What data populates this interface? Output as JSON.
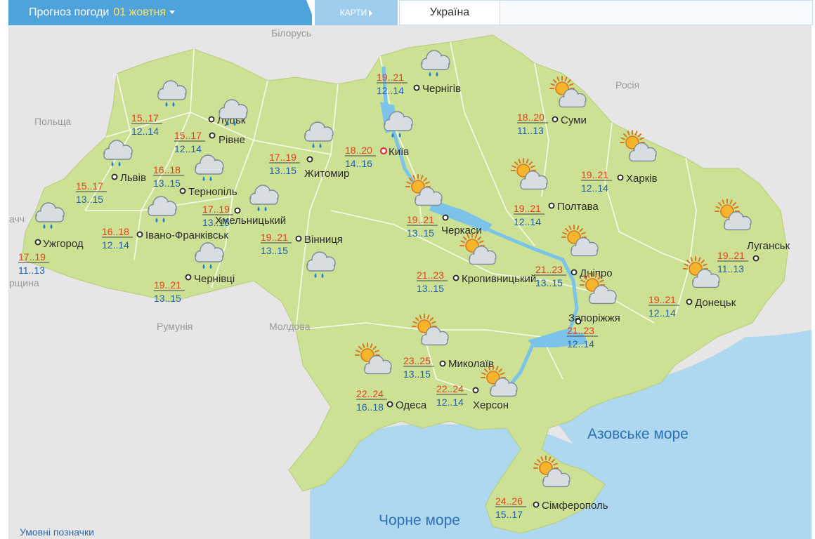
{
  "header": {
    "title": "Прогноз погоди",
    "date": "01 жовтня",
    "maps_tab": "КАРТИ",
    "region_tab": "Україна"
  },
  "neighbors": {
    "belarus": "Білорусь",
    "russia": "Росія",
    "poland": "Польща",
    "romania": "Румунія",
    "moldova": "Молдова",
    "slovakia_part": "ачч",
    "hungary_part": "рщина"
  },
  "seas": {
    "azov": "Азовське море",
    "black": "Чорне море"
  },
  "legend": "Умовні позначки",
  "colors": {
    "land": "#cde194",
    "foreign": "#e6e6e6",
    "sea": "#aed8f0",
    "day_temp": "#e0401c",
    "night_temp": "#1f5fb0"
  },
  "cities": [
    {
      "name": "Луцьк",
      "day": "15..17",
      "night": "12..14",
      "icon": "rain-icon"
    },
    {
      "name": "Рівне",
      "day": "15..17",
      "night": "12..14",
      "icon": "rain-icon"
    },
    {
      "name": "Львів",
      "day": "15..17",
      "night": "13..15",
      "icon": "rain-icon"
    },
    {
      "name": "Тернопіль",
      "day": "16..18",
      "night": "13..15",
      "icon": "rain-icon"
    },
    {
      "name": "Ужгород",
      "day": "17..19",
      "night": "11..13",
      "icon": "rain-icon"
    },
    {
      "name": "Івано-Франківськ",
      "day": "16..18",
      "night": "12..14",
      "icon": "rain-icon"
    },
    {
      "name": "Хмельницький",
      "day": "17..19",
      "night": "13..15",
      "icon": "rain-icon"
    },
    {
      "name": "Чернівці",
      "day": "19..21",
      "night": "13..15",
      "icon": "rain-icon"
    },
    {
      "name": "Житомир",
      "day": "17..19",
      "night": "13..15",
      "icon": "rain-icon"
    },
    {
      "name": "Вінниця",
      "day": "19..21",
      "night": "13..15",
      "icon": "rain-icon"
    },
    {
      "name": "Чернігів",
      "day": "19..21",
      "night": "12..14",
      "icon": "rain-icon"
    },
    {
      "name": "Київ",
      "day": "18..20",
      "night": "14..16",
      "icon": "rain-icon"
    },
    {
      "name": "Черкаси",
      "day": "19..21",
      "night": "13..15",
      "icon": "partly-sunny-icon"
    },
    {
      "name": "Кропивницький",
      "day": "21..23",
      "night": "13..15",
      "icon": "partly-sunny-icon"
    },
    {
      "name": "Суми",
      "day": "18..20",
      "night": "11..13",
      "icon": "partly-sunny-icon"
    },
    {
      "name": "Полтава",
      "day": "19..21",
      "night": "12..14",
      "icon": "partly-sunny-icon"
    },
    {
      "name": "Харків",
      "day": "19..21",
      "night": "12..14",
      "icon": "partly-sunny-icon"
    },
    {
      "name": "Дніпро",
      "day": "21..23",
      "night": "13..15",
      "icon": "partly-sunny-icon"
    },
    {
      "name": "Запоріжжя",
      "day": "21..23",
      "night": "12..14",
      "icon": "partly-sunny-icon"
    },
    {
      "name": "Луганськ",
      "day": "19..21",
      "night": "11..13",
      "icon": "partly-sunny-icon"
    },
    {
      "name": "Донецьк",
      "day": "19..21",
      "night": "12..14",
      "icon": "partly-sunny-icon"
    },
    {
      "name": "Миколаїв",
      "day": "23..25",
      "night": "13..15",
      "icon": "partly-sunny-icon"
    },
    {
      "name": "Одеса",
      "day": "22..24",
      "night": "16..18",
      "icon": "partly-sunny-icon"
    },
    {
      "name": "Херсон",
      "day": "22..24",
      "night": "12..14",
      "icon": "partly-sunny-icon"
    },
    {
      "name": "Сімферополь",
      "day": "24..26",
      "night": "15..17",
      "icon": "partly-sunny-icon"
    }
  ]
}
